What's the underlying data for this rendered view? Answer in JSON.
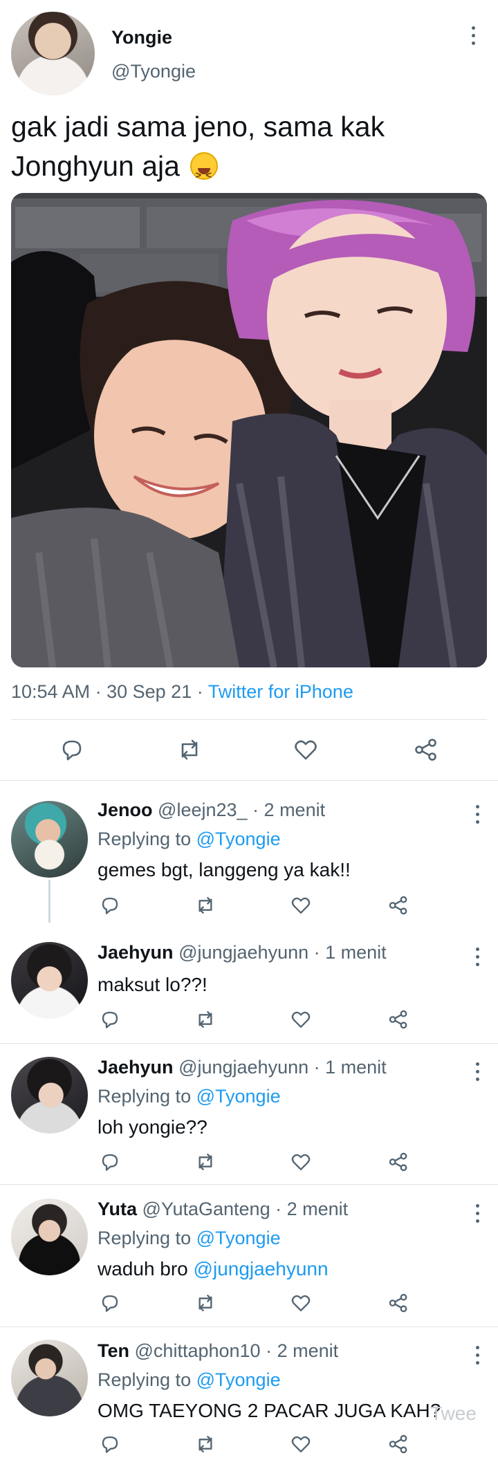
{
  "main_tweet": {
    "author_name": "Yongie",
    "author_handle": "@Tyongie",
    "text_line1": "gak jadi sama jeno, sama kak",
    "text_line2": "Jonghyun aja",
    "time": "10:54 AM",
    "date": "30 Sep 21",
    "source": "Twitter for iPhone",
    "sep": "·"
  },
  "icons": {
    "reply": "reply-icon",
    "retweet": "retweet-icon",
    "like": "like-icon",
    "share": "share-icon",
    "more": "more-icon"
  },
  "colors": {
    "text": "#0f1419",
    "secondary": "#536471",
    "link": "#1d9bf0",
    "divider": "#dfe3e6"
  },
  "replies": [
    {
      "name": "Jenoo",
      "handle": "@leejn23_",
      "time": "2 menit",
      "replying_label": "Replying to",
      "replying_to": "@Tyongie",
      "text": "gemes bgt, langgeng ya kak!!",
      "mention": ""
    },
    {
      "name": "Jaehyun",
      "handle": "@jungjaehyunn",
      "time": "1 menit",
      "replying_label": "",
      "replying_to": "",
      "text": "maksut lo??!",
      "mention": ""
    },
    {
      "name": "Jaehyun",
      "handle": "@jungjaehyunn",
      "time": "1 menit",
      "replying_label": "Replying to",
      "replying_to": "@Tyongie",
      "text": "loh yongie??",
      "mention": ""
    },
    {
      "name": "Yuta",
      "handle": "@YutaGanteng",
      "time": "2 menit",
      "replying_label": "Replying to",
      "replying_to": "@Tyongie",
      "text": "waduh bro ",
      "mention": "@jungjaehyunn"
    },
    {
      "name": "Ten",
      "handle": "@chittaphon10",
      "time": "2 menit",
      "replying_label": "Replying to",
      "replying_to": "@Tyongie",
      "text": "OMG TAEYONG 2 PACAR JUGA KAH?",
      "mention": ""
    }
  ],
  "watermark": "Twee"
}
